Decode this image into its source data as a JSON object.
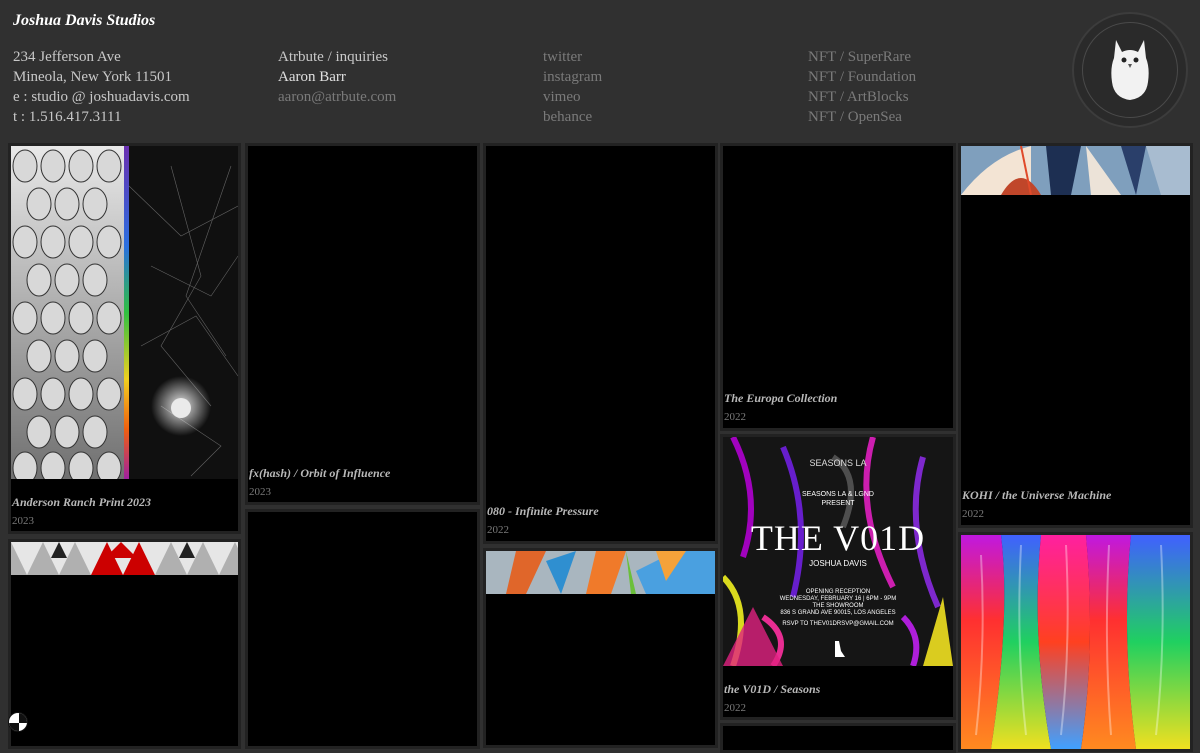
{
  "studio": {
    "title": "Joshua Davis Studios"
  },
  "address": {
    "street": "234 Jefferson Ave",
    "city": "Mineola, New York 11501",
    "email": "e : studio @ joshuadavis.com",
    "phone": "t : 1.516.417.3111"
  },
  "inquiries": {
    "label": "Atrbute / inquiries",
    "name": "Aaron Barr",
    "email": "aaron@atrbute.com"
  },
  "social": [
    "twitter",
    "instagram",
    "vimeo",
    "behance"
  ],
  "nft": [
    "NFT / SuperRare",
    "NFT / Foundation",
    "NFT / ArtBlocks",
    "NFT / OpenSea"
  ],
  "works": [
    {
      "title": "Anderson Ranch Print 2023",
      "year": "2023"
    },
    {
      "title": "fx(hash) / Orbit of Influence",
      "year": "2023"
    },
    {
      "title": "080 - Infinite Pressure",
      "year": "2022"
    },
    {
      "title": "The Europa Collection",
      "year": "2022"
    },
    {
      "title": "KOHI / the Universe Machine",
      "year": "2022"
    },
    {
      "title": "the V01D / Seasons",
      "year": "2022"
    }
  ],
  "poster": {
    "top": "SEASONS LA",
    "present_1": "SEASONS LA & LGND",
    "present_2": "PRESENT",
    "headline": "THE V01D",
    "artist": "JOSHUA DAVIS",
    "reception": "OPENING RECEPTION",
    "date": "WEDNESDAY, FEBRUARY 16 | 6PM - 9PM",
    "venue": "THE SHOWROOM",
    "address": "836 S GRAND AVE 90015, LOS ANGELES",
    "rsvp": "RSVP TO THEV01DRSVP@GMAIL.COM"
  },
  "colors": {
    "background": "#303030",
    "card": "#000000",
    "accent_red": "#cc0000"
  }
}
